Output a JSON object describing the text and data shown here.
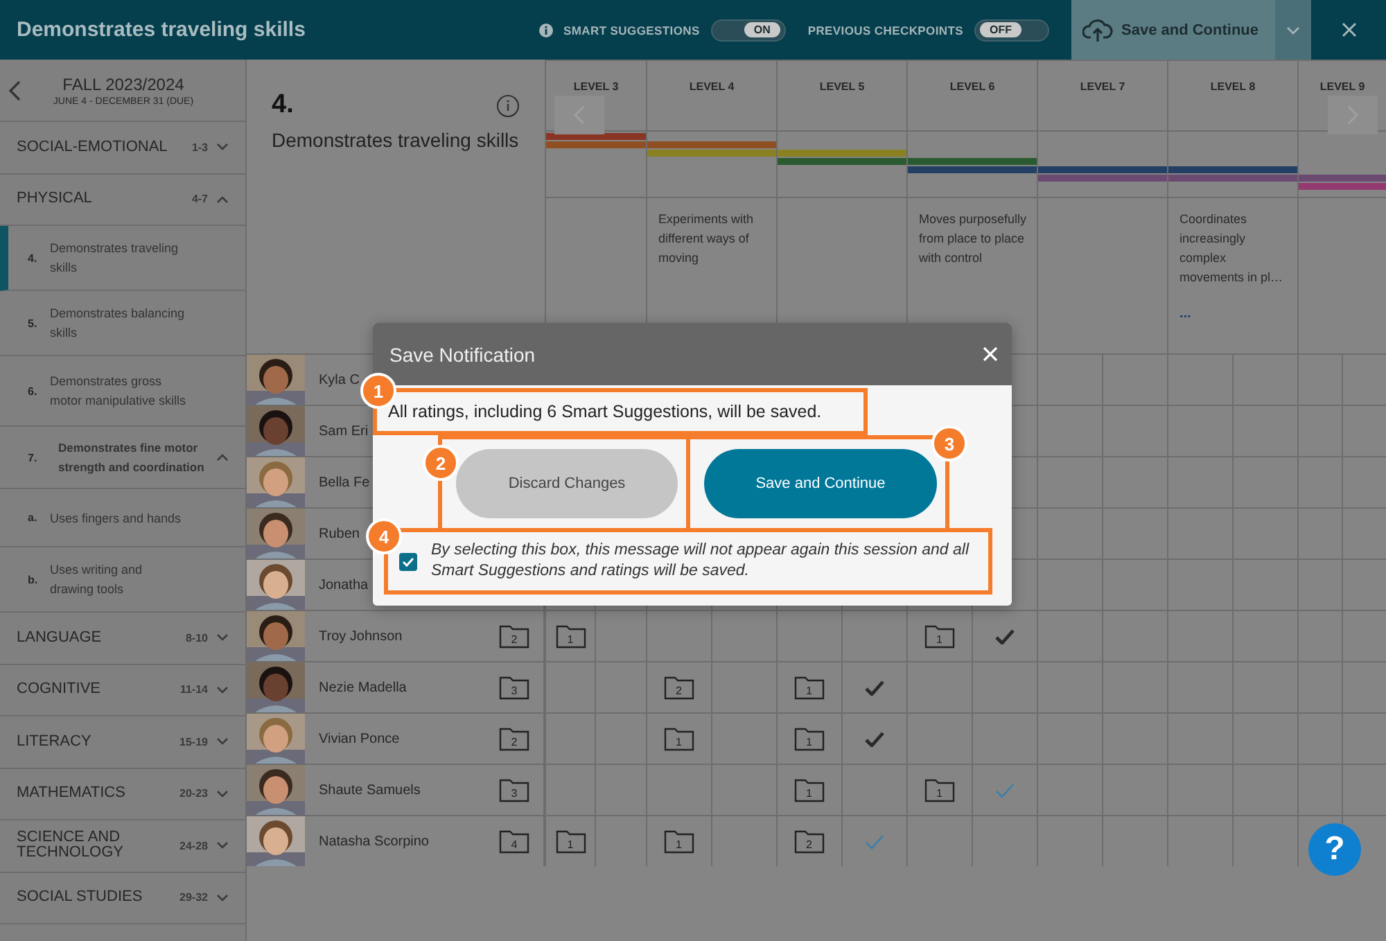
{
  "topbar": {
    "title": "Demonstrates traveling skills",
    "toggles": [
      {
        "label": "SMART SUGGESTIONS",
        "info": true,
        "on": true,
        "state_label": "ON"
      },
      {
        "label": "PREVIOUS CHECKPOINTS",
        "info": false,
        "on": false,
        "state_label": "OFF"
      }
    ],
    "save_label": "Save and Continue"
  },
  "sidebar": {
    "term": "FALL 2023/2024",
    "dates": "JUNE 4 - DECEMBER 31 (DUE)",
    "domains": [
      {
        "name": "SOCIAL-EMOTIONAL",
        "range": "1-3",
        "expanded": false
      },
      {
        "name": "PHYSICAL",
        "range": "4-7",
        "expanded": true,
        "children": [
          {
            "number": "4.",
            "label": "Demonstrates traveling skills",
            "selected": true
          },
          {
            "number": "5.",
            "label": "Demonstrates balancing skills",
            "selected": false
          },
          {
            "number": "6.",
            "label": "Demonstrates gross motor manipulative skills",
            "selected": false
          },
          {
            "number": "7.",
            "label": "Demonstrates fine motor strength and coordination",
            "selected": false,
            "expanded": true,
            "children": [
              {
                "number": "a.",
                "label": "Uses fingers and hands",
                "selected": false
              },
              {
                "number": "b.",
                "label": "Uses writing and drawing tools",
                "selected": false
              }
            ]
          }
        ]
      },
      {
        "name": "LANGUAGE",
        "range": "8-10",
        "expanded": false
      },
      {
        "name": "COGNITIVE",
        "range": "11-14",
        "expanded": false
      },
      {
        "name": "LITERACY",
        "range": "15-19",
        "expanded": false
      },
      {
        "name": "MATHEMATICS",
        "range": "20-23",
        "expanded": false
      },
      {
        "name": "SCIENCE AND TECHNOLOGY",
        "range": "24-28",
        "expanded": false
      },
      {
        "name": "SOCIAL STUDIES",
        "range": "29-32",
        "expanded": false
      }
    ]
  },
  "objective": {
    "number": "4.",
    "title": "Demonstrates traveling skills"
  },
  "levels": [
    {
      "label": "LEVEL 3",
      "bands": [
        {
          "color": "#8a3524"
        },
        {
          "color": "#8f4f22"
        }
      ]
    },
    {
      "label": "LEVEL 4",
      "bands": [
        {
          "color": "#8f4f22"
        },
        {
          "color": "#8a8222"
        }
      ],
      "descriptor": "Experiments with different ways of moving"
    },
    {
      "label": "LEVEL 5",
      "bands": [
        {
          "color": "#8a8222"
        },
        {
          "color": "#2a5a30"
        }
      ]
    },
    {
      "label": "LEVEL 6",
      "bands": [
        {
          "color": "#2a5a30"
        },
        {
          "color": "#243f64"
        }
      ],
      "descriptor": "Moves purposefully from place to place with control"
    },
    {
      "label": "LEVEL 7",
      "bands": [
        {
          "color": "#243f64"
        },
        {
          "color": "#6a4a70"
        }
      ]
    },
    {
      "label": "LEVEL 8",
      "bands": [
        {
          "color": "#243f64"
        },
        {
          "color": "#6a4a70"
        }
      ],
      "descriptor": "Coordinates increasingly complex movements in pl…",
      "more": "..."
    },
    {
      "label": "LEVEL 9",
      "bands": [
        {
          "color": "#6a4a70"
        },
        {
          "color": "#953a70"
        }
      ]
    }
  ],
  "students": [
    {
      "name": "Kyla C"
    },
    {
      "name": "Sam Eri"
    },
    {
      "name": "Bella Fe"
    },
    {
      "name": "Ruben"
    },
    {
      "name": "Jonatha"
    },
    {
      "name": "Troy Johnson",
      "total": "2",
      "cells": [
        {
          "folder": "1"
        },
        {},
        {},
        {
          "folder": "1",
          "checked": true,
          "suggested": false
        }
      ]
    },
    {
      "name": "Nezie Madella",
      "total": "3",
      "cells": [
        {},
        {
          "folder": "2"
        },
        {
          "folder": "1",
          "checked": true,
          "suggested": false
        }
      ]
    },
    {
      "name": "Vivian Ponce",
      "total": "2",
      "cells": [
        {},
        {
          "folder": "1"
        },
        {
          "folder": "1",
          "checked": true,
          "suggested": false
        }
      ]
    },
    {
      "name": "Shaute Samuels",
      "total": "3",
      "cells": [
        {},
        {},
        {
          "folder": "1"
        },
        {
          "folder": "1",
          "checked": true,
          "suggested": true
        }
      ]
    },
    {
      "name": "Natasha Scorpino",
      "total": "4",
      "cells": [
        {
          "folder": "1"
        },
        {
          "folder": "1"
        },
        {
          "folder": "2",
          "checked": true,
          "suggested": true
        }
      ]
    }
  ],
  "modal": {
    "title": "Save Notification",
    "message": {
      "text": "All ratings, including 6 Smart Suggestions, will be saved.",
      "callout": "1"
    },
    "buttons": [
      {
        "label": "Discard Changes",
        "kind": "secondary",
        "callout": "2"
      },
      {
        "label": "Save and Continue",
        "kind": "primary",
        "callout": "3"
      }
    ],
    "confirm": {
      "checked": true,
      "text": "By selecting this box, this message will not appear again this session and all Smart Suggestions and ratings will be saved.",
      "callout": "4"
    }
  },
  "help": "?"
}
